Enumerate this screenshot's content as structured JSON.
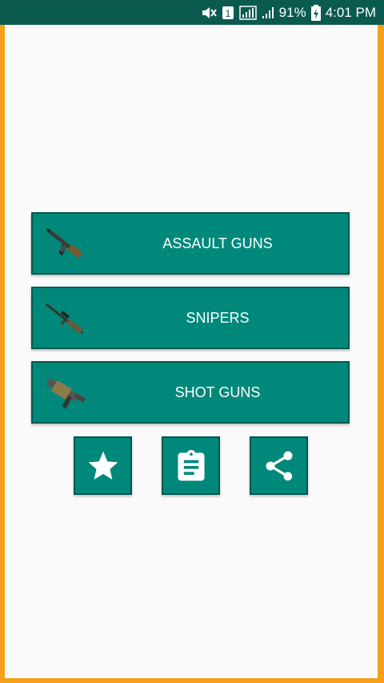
{
  "status_bar": {
    "battery": "91%",
    "time": "4:01 PM",
    "sim_badge": "1",
    "icons": [
      "mute-icon",
      "sim-icon",
      "signal-icon",
      "signal-icon-2",
      "battery-icon"
    ]
  },
  "menu": {
    "items": [
      {
        "label": "ASSAULT GUNS",
        "icon": "assault-rifle-icon"
      },
      {
        "label": "SNIPERS",
        "icon": "sniper-rifle-icon"
      },
      {
        "label": "SHOT GUNS",
        "icon": "shotgun-icon"
      }
    ]
  },
  "actions": [
    {
      "icon": "star-icon"
    },
    {
      "icon": "clipboard-icon"
    },
    {
      "icon": "share-icon"
    }
  ],
  "colors": {
    "frame": "#f5a01a",
    "status_bar": "#0b5a50",
    "button": "#00897b",
    "button_border": "#00584e",
    "background": "#fafafa"
  }
}
